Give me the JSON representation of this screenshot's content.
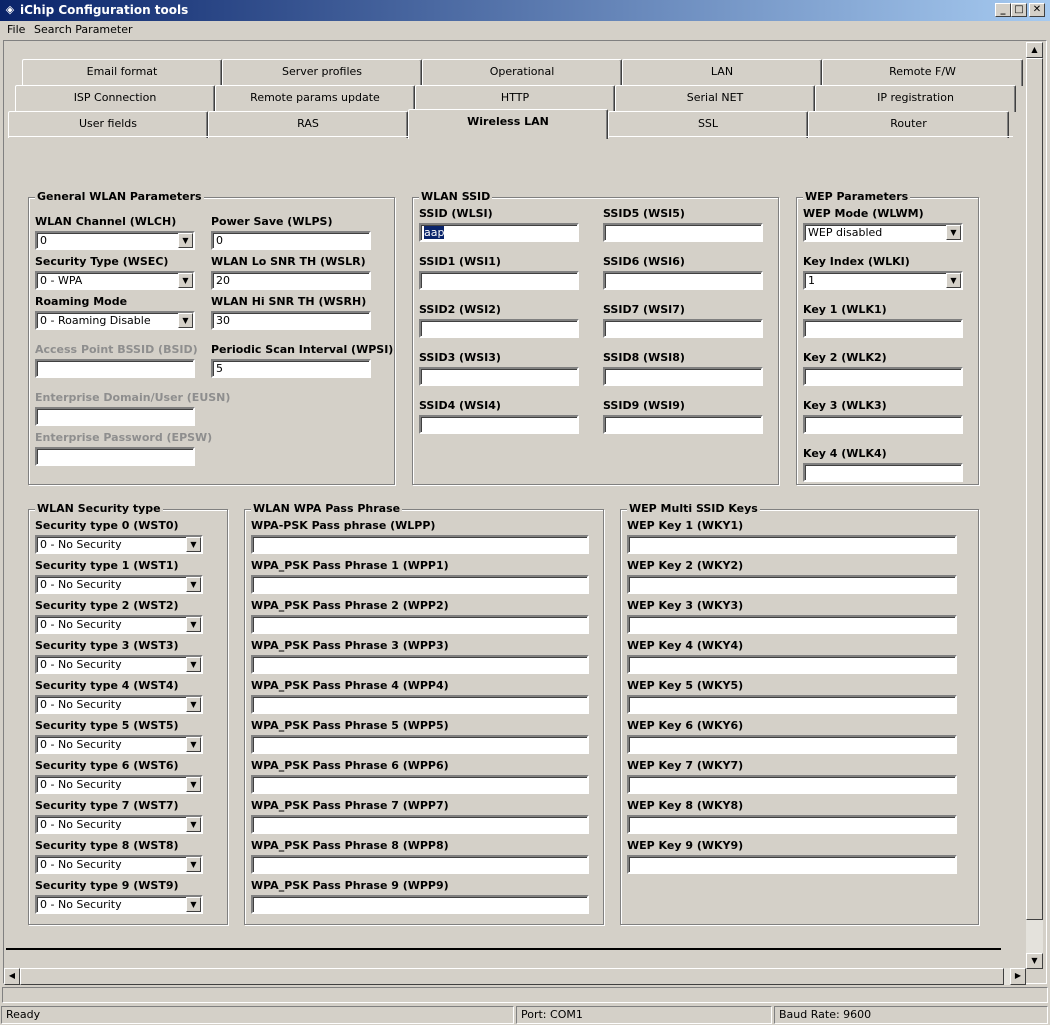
{
  "window": {
    "title": "iChip Configuration tools",
    "minimize": "_",
    "maximize": "□",
    "close": "✕"
  },
  "menu": [
    "File",
    "Search Parameter"
  ],
  "tabs": {
    "row1": [
      "Email format",
      "Server profiles",
      "Operational",
      "LAN",
      "Remote F/W"
    ],
    "row2": [
      "ISP Connection",
      "Remote params update",
      "HTTP",
      "Serial NET",
      "IP registration"
    ],
    "row3": [
      "User fields",
      "RAS",
      "Wireless LAN",
      "SSL",
      "Router"
    ],
    "active": "Wireless LAN"
  },
  "general": {
    "title": "General WLAN Parameters",
    "channel_label": "WLAN Channel (WLCH)",
    "channel_value": "0",
    "powersave_label": "Power Save (WLPS)",
    "powersave_value": "0",
    "sectype_label": "Security Type (WSEC)",
    "sectype_value": "0 - WPA",
    "lo_snr_label": "WLAN Lo SNR TH (WSLR)",
    "lo_snr_value": "20",
    "roaming_label": "Roaming Mode",
    "roaming_value": "0 - Roaming Disable",
    "hi_snr_label": "WLAN Hi SNR TH (WSRH)",
    "hi_snr_value": "30",
    "bssid_label": "Access Point BSSID (BSID)",
    "bssid_value": "",
    "scan_label": "Periodic Scan Interval (WPSI)",
    "scan_value": "5",
    "eusn_label": "Enterprise Domain/User (EUSN)",
    "eusn_value": "",
    "epsw_label": "Enterprise Password (EPSW)",
    "epsw_value": ""
  },
  "ssid": {
    "title": "WLAN SSID",
    "items": [
      {
        "label": "SSID (WLSI)",
        "value": "aap"
      },
      {
        "label": "SSID1 (WSI1)",
        "value": ""
      },
      {
        "label": "SSID2 (WSI2)",
        "value": ""
      },
      {
        "label": "SSID3 (WSI3)",
        "value": ""
      },
      {
        "label": "SSID4 (WSI4)",
        "value": ""
      },
      {
        "label": "SSID5 (WSI5)",
        "value": ""
      },
      {
        "label": "SSID6 (WSI6)",
        "value": ""
      },
      {
        "label": "SSID7 (WSI7)",
        "value": ""
      },
      {
        "label": "SSID8 (WSI8)",
        "value": ""
      },
      {
        "label": "SSID9 (WSI9)",
        "value": ""
      }
    ]
  },
  "wep": {
    "title": "WEP Parameters",
    "mode_label": "WEP Mode (WLWM)",
    "mode_value": "WEP disabled",
    "index_label": "Key Index (WLKI)",
    "index_value": "1",
    "keys": [
      {
        "label": "Key 1 (WLK1)",
        "value": ""
      },
      {
        "label": "Key 2 (WLK2)",
        "value": ""
      },
      {
        "label": "Key 3 (WLK3)",
        "value": ""
      },
      {
        "label": "Key 4 (WLK4)",
        "value": ""
      }
    ]
  },
  "sectypes": {
    "title": "WLAN Security type",
    "items": [
      {
        "label": "Security type 0 (WST0)",
        "value": "0 - No Security"
      },
      {
        "label": "Security type 1 (WST1)",
        "value": "0 - No Security"
      },
      {
        "label": "Security type 2 (WST2)",
        "value": "0 - No Security"
      },
      {
        "label": "Security type 3 (WST3)",
        "value": "0 - No Security"
      },
      {
        "label": "Security type 4 (WST4)",
        "value": "0 - No Security"
      },
      {
        "label": "Security type 5 (WST5)",
        "value": "0 - No Security"
      },
      {
        "label": "Security type 6 (WST6)",
        "value": "0 - No Security"
      },
      {
        "label": "Security type 7 (WST7)",
        "value": "0 - No Security"
      },
      {
        "label": "Security type 8 (WST8)",
        "value": "0 - No Security"
      },
      {
        "label": "Security type 9 (WST9)",
        "value": "0 - No Security"
      }
    ]
  },
  "wpa": {
    "title": "WLAN WPA Pass Phrase",
    "items": [
      {
        "label": "WPA-PSK Pass phrase (WLPP)",
        "value": ""
      },
      {
        "label": "WPA_PSK Pass Phrase 1 (WPP1)",
        "value": ""
      },
      {
        "label": "WPA_PSK Pass Phrase 2 (WPP2)",
        "value": ""
      },
      {
        "label": "WPA_PSK Pass Phrase 3 (WPP3)",
        "value": ""
      },
      {
        "label": "WPA_PSK Pass Phrase 4 (WPP4)",
        "value": ""
      },
      {
        "label": "WPA_PSK Pass Phrase 5 (WPP5)",
        "value": ""
      },
      {
        "label": "WPA_PSK Pass Phrase 6 (WPP6)",
        "value": ""
      },
      {
        "label": "WPA_PSK Pass Phrase 7 (WPP7)",
        "value": ""
      },
      {
        "label": "WPA_PSK Pass Phrase 8 (WPP8)",
        "value": ""
      },
      {
        "label": "WPA_PSK Pass Phrase 9 (WPP9)",
        "value": ""
      }
    ]
  },
  "wepmulti": {
    "title": "WEP Multi SSID Keys",
    "items": [
      {
        "label": "WEP Key 1 (WKY1)",
        "value": ""
      },
      {
        "label": "WEP Key 2 (WKY2)",
        "value": ""
      },
      {
        "label": "WEP Key 3 (WKY3)",
        "value": ""
      },
      {
        "label": "WEP Key 4 (WKY4)",
        "value": ""
      },
      {
        "label": "WEP Key 5 (WKY5)",
        "value": ""
      },
      {
        "label": "WEP Key 6 (WKY6)",
        "value": ""
      },
      {
        "label": "WEP Key 7 (WKY7)",
        "value": ""
      },
      {
        "label": "WEP Key 8 (WKY8)",
        "value": ""
      },
      {
        "label": "WEP Key 9 (WKY9)",
        "value": ""
      }
    ]
  },
  "status": {
    "state": "Ready",
    "port": "Port: COM1",
    "baud": "Baud Rate: 9600"
  },
  "colors": {
    "titlebar_start": "#0a246a",
    "titlebar_end": "#a6caf0",
    "face": "#d4d0c8",
    "disabled_text": "#8e8e8e",
    "selection": "#0a246a"
  },
  "icons": {
    "app": "chip-icon",
    "dropdown": "chevron-down-icon"
  }
}
